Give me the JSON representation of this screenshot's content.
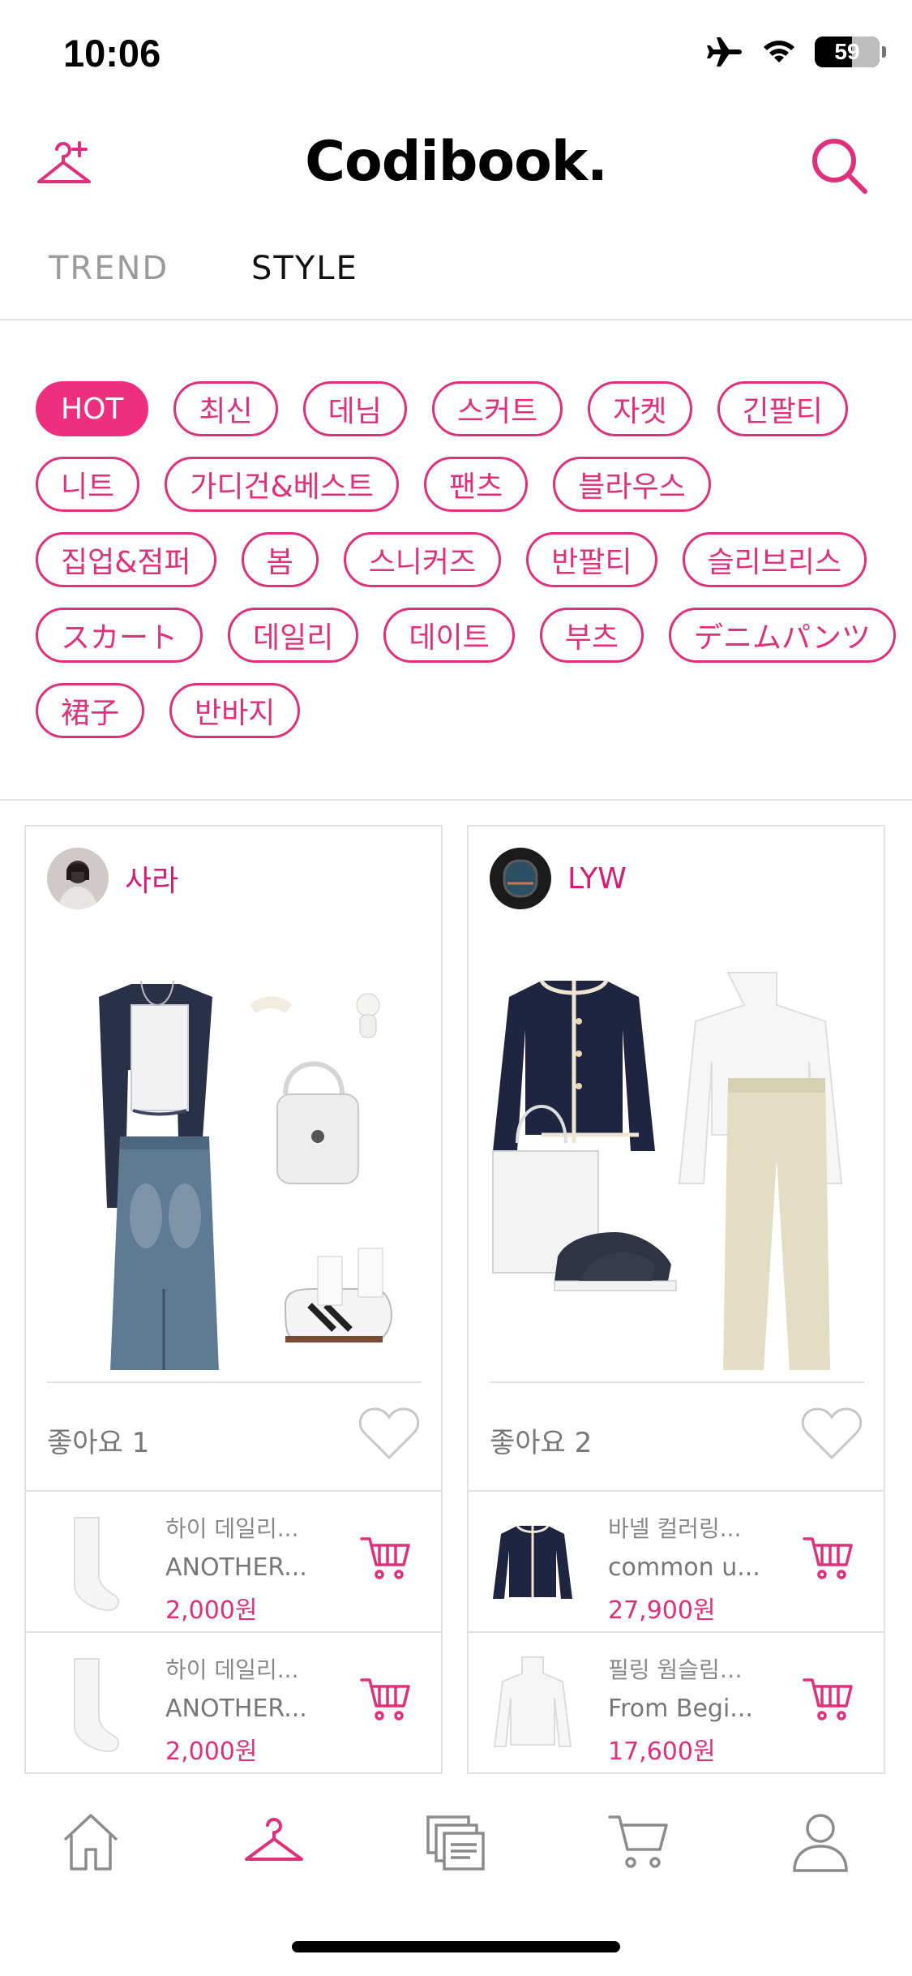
{
  "status_bar": {
    "time": "10:06",
    "battery": "59",
    "icons": [
      "airplane-icon",
      "wifi-icon",
      "battery-icon"
    ]
  },
  "header": {
    "logo": "Codibook.",
    "left_icon": "hanger-plus-icon",
    "right_icon": "search-icon"
  },
  "tabs": [
    {
      "label": "TREND",
      "active": false
    },
    {
      "label": "STYLE",
      "active": true
    }
  ],
  "chips": {
    "row1": [
      "HOT",
      "최신",
      "데님",
      "스커트",
      "자켓",
      "긴팔티"
    ],
    "row2": [
      "니트",
      "가디건&베스트",
      "팬츠",
      "블라우스"
    ],
    "row3": [
      "집업&점퍼",
      "봄",
      "스니커즈",
      "반팔티",
      "슬리브리스"
    ],
    "row4": [
      "スカート",
      "데일리",
      "데이트",
      "부츠",
      "デニムパンツ"
    ],
    "row5": [
      "裙子",
      "반바지"
    ]
  },
  "cards": [
    {
      "username": "사라",
      "likes": "좋아요 1",
      "products": [
        {
          "name": "하이 데일리...",
          "brand": "ANOTHER...",
          "price": "2,000원"
        },
        {
          "name": "하이 데일리...",
          "brand": "ANOTHER...",
          "price": "2,000원"
        }
      ]
    },
    {
      "username": "LYW",
      "likes": "좋아요 2",
      "products": [
        {
          "name": "바넬 컬러링...",
          "brand": "common u...",
          "price": "27,900원"
        },
        {
          "name": "필링 웜슬림…",
          "brand": "From Begi...",
          "price": "17,600원"
        }
      ]
    }
  ],
  "bottom_nav": {
    "items": [
      "home-icon",
      "hanger-icon",
      "collection-icon",
      "cart-icon",
      "profile-icon"
    ],
    "active": "hanger-icon"
  },
  "colors": {
    "accent": "#e0307c",
    "accent_fill": "#ee2f7f",
    "username": "#d41d73"
  }
}
